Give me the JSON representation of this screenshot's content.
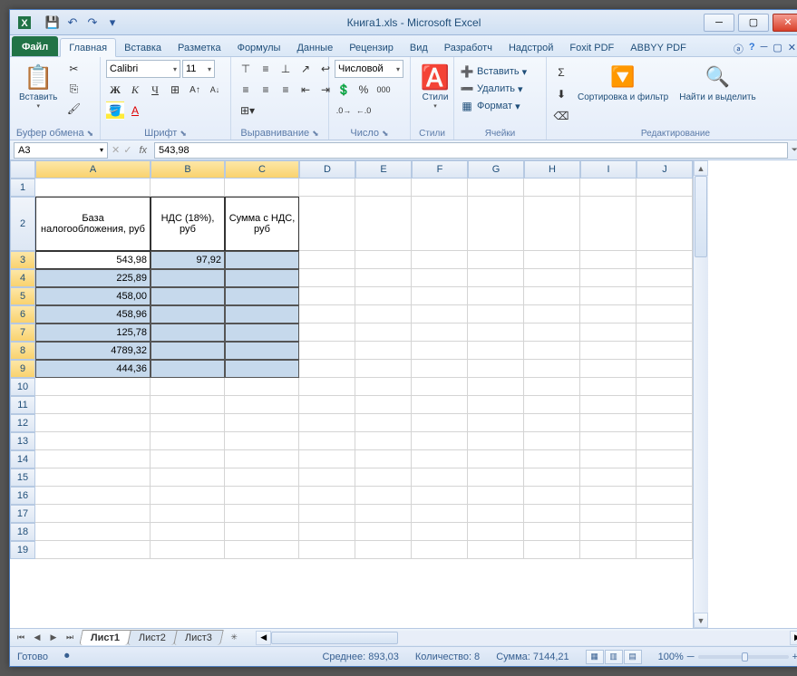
{
  "title": "Книга1.xls  -  Microsoft Excel",
  "ribbon": {
    "file": "Файл",
    "tabs": [
      "Главная",
      "Вставка",
      "Разметка",
      "Формулы",
      "Данные",
      "Рецензир",
      "Вид",
      "Разработч",
      "Надстрой",
      "Foxit PDF",
      "ABBYY PDF"
    ],
    "groups": {
      "clipboard": {
        "paste": "Вставить",
        "label": "Буфер обмена"
      },
      "font": {
        "name": "Calibri",
        "size": "11",
        "bold": "Ж",
        "italic": "К",
        "underline": "Ч",
        "label": "Шрифт"
      },
      "align": {
        "label": "Выравнивание"
      },
      "number": {
        "fmt": "Числовой",
        "label": "Число"
      },
      "styles": {
        "label": "Стили",
        "btn": "Стили"
      },
      "cells": {
        "insert": "Вставить",
        "delete": "Удалить",
        "format": "Формат",
        "label": "Ячейки"
      },
      "editing": {
        "sort": "Сортировка и фильтр",
        "find": "Найти и выделить",
        "label": "Редактирование"
      }
    }
  },
  "namebox": "A3",
  "formula": "543,98",
  "columns": [
    "A",
    "B",
    "C",
    "D",
    "E",
    "F",
    "G",
    "H",
    "I",
    "J"
  ],
  "rows_after": [
    "10",
    "11",
    "12",
    "13",
    "14",
    "15",
    "16",
    "17",
    "18",
    "19"
  ],
  "headers": {
    "A": "База налогообложения, руб",
    "B": "НДС (18%), руб",
    "C": "Сумма с НДС, руб"
  },
  "cells": {
    "A3": "543,98",
    "B3": "97,92",
    "A4": "225,89",
    "A5": "458,00",
    "A6": "458,96",
    "A7": "125,78",
    "A8": "4789,32",
    "A9": "444,36"
  },
  "sheets": [
    "Лист1",
    "Лист2",
    "Лист3"
  ],
  "status": {
    "ready": "Готово",
    "avg": "Среднее: 893,03",
    "count": "Количество: 8",
    "sum": "Сумма: 7144,21",
    "zoom": "100%"
  }
}
